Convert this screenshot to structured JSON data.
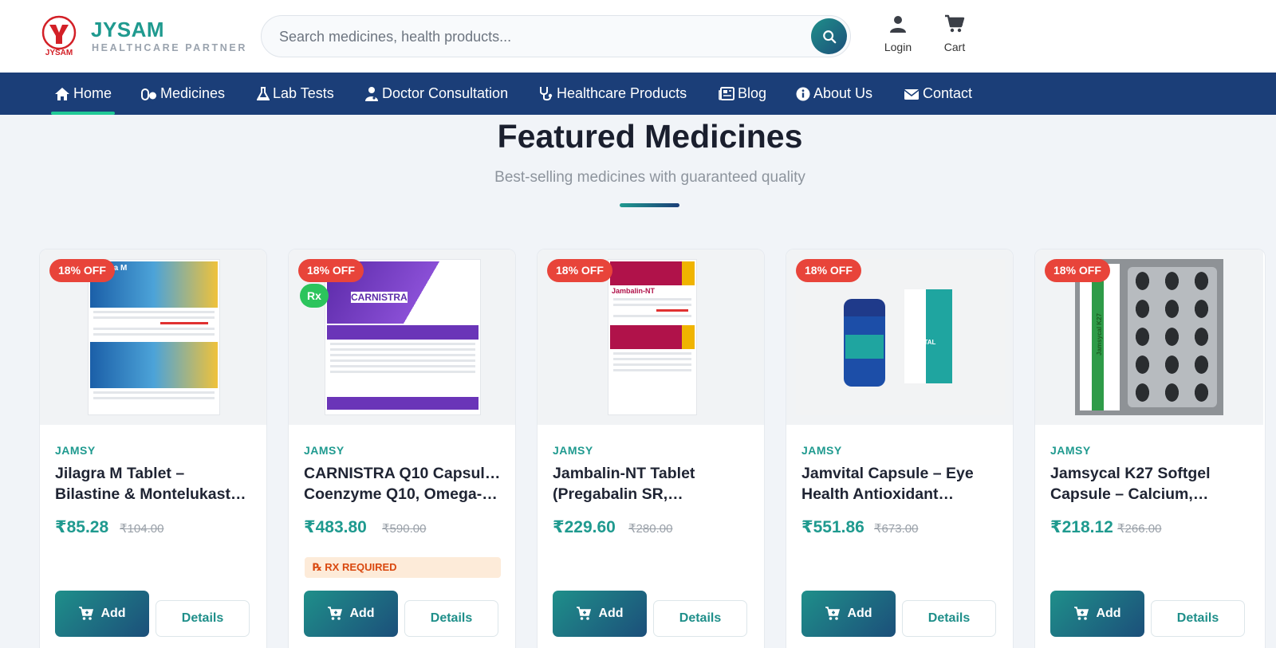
{
  "header": {
    "logo_text": "JYSAM",
    "brand_name": "JYSAM",
    "brand_tagline": "HEALTHCARE PARTNER",
    "search_placeholder": "Search medicines, health products...",
    "login_label": "Login",
    "cart_label": "Cart"
  },
  "nav": {
    "items": [
      {
        "label": "Home",
        "icon": "home-icon"
      },
      {
        "label": "Medicines",
        "icon": "pills-icon"
      },
      {
        "label": "Lab Tests",
        "icon": "flask-icon"
      },
      {
        "label": "Doctor Consultation",
        "icon": "doctor-icon"
      },
      {
        "label": "Healthcare Products",
        "icon": "stethoscope-icon"
      },
      {
        "label": "Blog",
        "icon": "newspaper-icon"
      },
      {
        "label": "About Us",
        "icon": "info-icon"
      },
      {
        "label": "Contact",
        "icon": "envelope-icon"
      }
    ],
    "active": "Home"
  },
  "section": {
    "title": "Featured Medicines",
    "subtitle": "Best-selling medicines with guaranteed quality"
  },
  "products": [
    {
      "discount": "18% OFF",
      "brand": "JAMSY",
      "name_line1": "Jilagra M Tablet –",
      "name_line2": "Bilastine & Montelukast…",
      "price": "₹85.28",
      "mrp": "₹104.00",
      "rx": false,
      "image_label": "Jilagra M"
    },
    {
      "discount": "18% OFF",
      "rx_badge": "Rx",
      "brand": "JAMSY",
      "name_line1": "CARNISTRA Q10 Capsule –",
      "name_line2": "Coenzyme Q10, Omega-…",
      "price": "₹483.80",
      "mrp": "₹590.00",
      "rx": true,
      "rx_text": "RX REQUIRED",
      "image_label": "CARNISTRA"
    },
    {
      "discount": "18% OFF",
      "brand": "JAMSY",
      "name_line1": "Jambalin-NT Tablet",
      "name_line2": "(Pregabalin SR,…",
      "price": "₹229.60",
      "mrp": "₹280.00",
      "rx": false,
      "image_label": "Jambalin-NT"
    },
    {
      "discount": "18% OFF",
      "brand": "JAMSY",
      "name_line1": "Jamvital Capsule – Eye",
      "name_line2": "Health Antioxidant…",
      "price": "₹551.86",
      "mrp": "₹673.00",
      "rx": false,
      "image_label": "JAMVITAL"
    },
    {
      "discount": "18% OFF",
      "brand": "JAMSY",
      "name_line1": "Jamsycal K27 Softgel",
      "name_line2": "Capsule – Calcium,…",
      "price": "₹218.12",
      "mrp": "₹266.00",
      "rx": false,
      "image_label": "Jamsycal K27"
    }
  ],
  "buttons": {
    "add_label": "Add",
    "details_label": "Details"
  },
  "colors": {
    "brand_teal": "#1f9a8f",
    "nav_navy": "#1b3e78",
    "discount_red": "#e8443a",
    "rx_green": "#2cc45c"
  }
}
